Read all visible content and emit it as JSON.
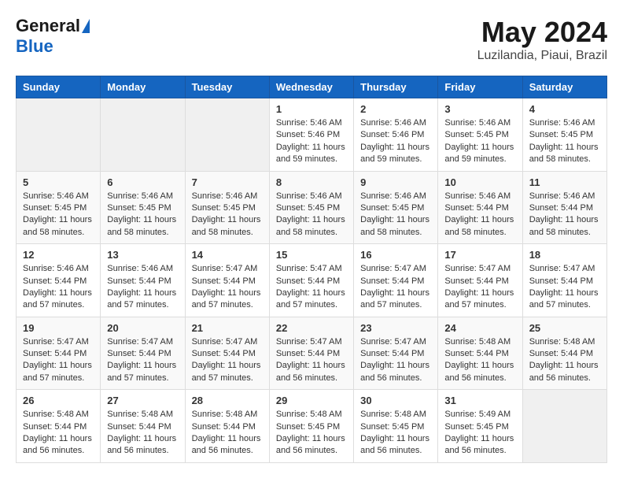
{
  "header": {
    "logo_general": "General",
    "logo_blue": "Blue",
    "month_year": "May 2024",
    "location": "Luzilandia, Piaui, Brazil"
  },
  "days_of_week": [
    "Sunday",
    "Monday",
    "Tuesday",
    "Wednesday",
    "Thursday",
    "Friday",
    "Saturday"
  ],
  "weeks": [
    [
      {
        "day": "",
        "content": ""
      },
      {
        "day": "",
        "content": ""
      },
      {
        "day": "",
        "content": ""
      },
      {
        "day": "1",
        "content": "Sunrise: 5:46 AM\nSunset: 5:46 PM\nDaylight: 11 hours and 59 minutes."
      },
      {
        "day": "2",
        "content": "Sunrise: 5:46 AM\nSunset: 5:46 PM\nDaylight: 11 hours and 59 minutes."
      },
      {
        "day": "3",
        "content": "Sunrise: 5:46 AM\nSunset: 5:45 PM\nDaylight: 11 hours and 59 minutes."
      },
      {
        "day": "4",
        "content": "Sunrise: 5:46 AM\nSunset: 5:45 PM\nDaylight: 11 hours and 58 minutes."
      }
    ],
    [
      {
        "day": "5",
        "content": "Sunrise: 5:46 AM\nSunset: 5:45 PM\nDaylight: 11 hours and 58 minutes."
      },
      {
        "day": "6",
        "content": "Sunrise: 5:46 AM\nSunset: 5:45 PM\nDaylight: 11 hours and 58 minutes."
      },
      {
        "day": "7",
        "content": "Sunrise: 5:46 AM\nSunset: 5:45 PM\nDaylight: 11 hours and 58 minutes."
      },
      {
        "day": "8",
        "content": "Sunrise: 5:46 AM\nSunset: 5:45 PM\nDaylight: 11 hours and 58 minutes."
      },
      {
        "day": "9",
        "content": "Sunrise: 5:46 AM\nSunset: 5:45 PM\nDaylight: 11 hours and 58 minutes."
      },
      {
        "day": "10",
        "content": "Sunrise: 5:46 AM\nSunset: 5:44 PM\nDaylight: 11 hours and 58 minutes."
      },
      {
        "day": "11",
        "content": "Sunrise: 5:46 AM\nSunset: 5:44 PM\nDaylight: 11 hours and 58 minutes."
      }
    ],
    [
      {
        "day": "12",
        "content": "Sunrise: 5:46 AM\nSunset: 5:44 PM\nDaylight: 11 hours and 57 minutes."
      },
      {
        "day": "13",
        "content": "Sunrise: 5:46 AM\nSunset: 5:44 PM\nDaylight: 11 hours and 57 minutes."
      },
      {
        "day": "14",
        "content": "Sunrise: 5:47 AM\nSunset: 5:44 PM\nDaylight: 11 hours and 57 minutes."
      },
      {
        "day": "15",
        "content": "Sunrise: 5:47 AM\nSunset: 5:44 PM\nDaylight: 11 hours and 57 minutes."
      },
      {
        "day": "16",
        "content": "Sunrise: 5:47 AM\nSunset: 5:44 PM\nDaylight: 11 hours and 57 minutes."
      },
      {
        "day": "17",
        "content": "Sunrise: 5:47 AM\nSunset: 5:44 PM\nDaylight: 11 hours and 57 minutes."
      },
      {
        "day": "18",
        "content": "Sunrise: 5:47 AM\nSunset: 5:44 PM\nDaylight: 11 hours and 57 minutes."
      }
    ],
    [
      {
        "day": "19",
        "content": "Sunrise: 5:47 AM\nSunset: 5:44 PM\nDaylight: 11 hours and 57 minutes."
      },
      {
        "day": "20",
        "content": "Sunrise: 5:47 AM\nSunset: 5:44 PM\nDaylight: 11 hours and 57 minutes."
      },
      {
        "day": "21",
        "content": "Sunrise: 5:47 AM\nSunset: 5:44 PM\nDaylight: 11 hours and 57 minutes."
      },
      {
        "day": "22",
        "content": "Sunrise: 5:47 AM\nSunset: 5:44 PM\nDaylight: 11 hours and 56 minutes."
      },
      {
        "day": "23",
        "content": "Sunrise: 5:47 AM\nSunset: 5:44 PM\nDaylight: 11 hours and 56 minutes."
      },
      {
        "day": "24",
        "content": "Sunrise: 5:48 AM\nSunset: 5:44 PM\nDaylight: 11 hours and 56 minutes."
      },
      {
        "day": "25",
        "content": "Sunrise: 5:48 AM\nSunset: 5:44 PM\nDaylight: 11 hours and 56 minutes."
      }
    ],
    [
      {
        "day": "26",
        "content": "Sunrise: 5:48 AM\nSunset: 5:44 PM\nDaylight: 11 hours and 56 minutes."
      },
      {
        "day": "27",
        "content": "Sunrise: 5:48 AM\nSunset: 5:44 PM\nDaylight: 11 hours and 56 minutes."
      },
      {
        "day": "28",
        "content": "Sunrise: 5:48 AM\nSunset: 5:44 PM\nDaylight: 11 hours and 56 minutes."
      },
      {
        "day": "29",
        "content": "Sunrise: 5:48 AM\nSunset: 5:45 PM\nDaylight: 11 hours and 56 minutes."
      },
      {
        "day": "30",
        "content": "Sunrise: 5:48 AM\nSunset: 5:45 PM\nDaylight: 11 hours and 56 minutes."
      },
      {
        "day": "31",
        "content": "Sunrise: 5:49 AM\nSunset: 5:45 PM\nDaylight: 11 hours and 56 minutes."
      },
      {
        "day": "",
        "content": ""
      }
    ]
  ]
}
